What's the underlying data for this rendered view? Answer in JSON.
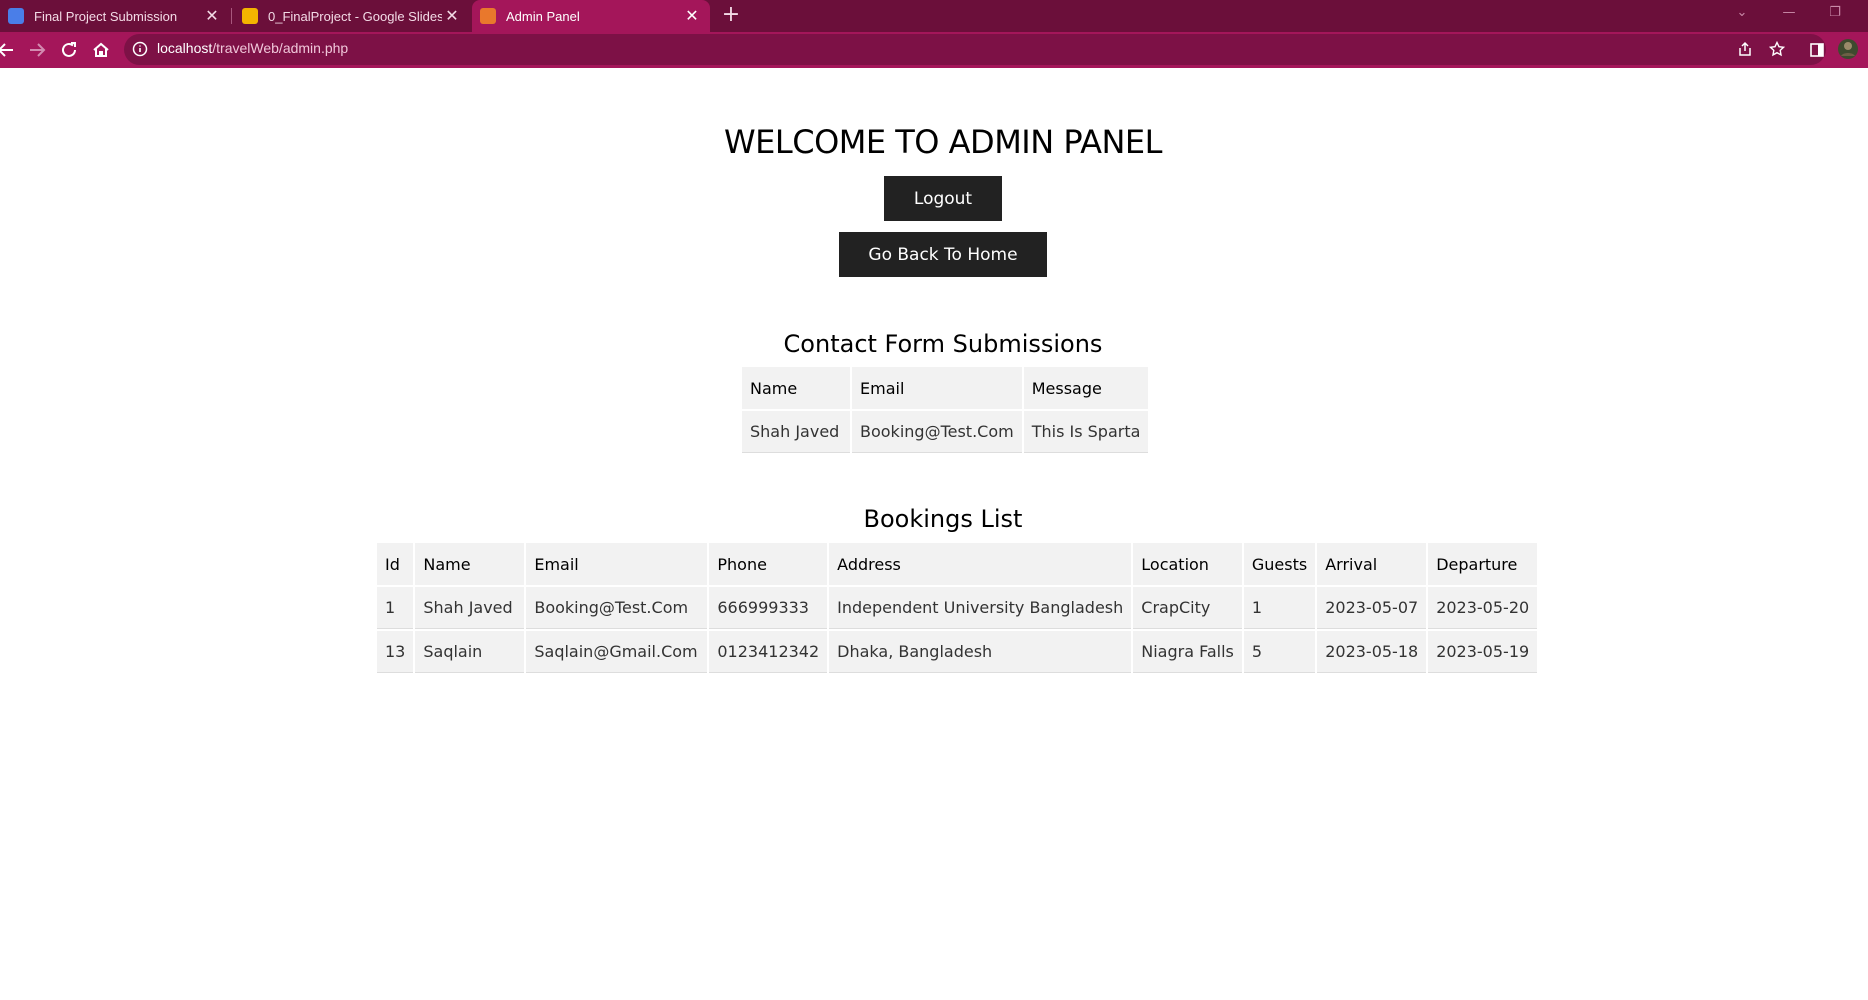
{
  "browser": {
    "tabs": [
      {
        "label": "Final Project Submission",
        "favicon": "#4a7ee8",
        "active": false
      },
      {
        "label": "0_FinalProject - Google Slides",
        "favicon": "#f4b400",
        "active": false
      },
      {
        "label": "Admin Panel",
        "favicon": "#e9782c",
        "active": true
      }
    ],
    "new_tab": "+",
    "url_host": "localhost",
    "url_path": "/travelWeb/admin.php",
    "colors": {
      "tabbar": "#6b0f3a",
      "toolbar": "#a4165a",
      "omnibox": "#7d1146"
    }
  },
  "page": {
    "title": "WELCOME TO ADMIN PANEL",
    "logout_label": "Logout",
    "home_label": "Go Back To Home",
    "contact": {
      "title": "Contact Form Submissions",
      "headers": [
        "Name",
        "Email",
        "Message"
      ],
      "rows": [
        [
          "Shah Javed",
          "Booking@Test.Com",
          "This Is Sparta"
        ]
      ]
    },
    "bookings": {
      "title": "Bookings List",
      "headers": [
        "Id",
        "Name",
        "Email",
        "Phone",
        "Address",
        "Location",
        "Guests",
        "Arrival",
        "Departure"
      ],
      "rows": [
        [
          "1",
          "Shah Javed",
          "Booking@Test.Com",
          "666999333",
          "Independent University Bangladesh",
          "CrapCity",
          "1",
          "2023-05-07",
          "2023-05-20"
        ],
        [
          "13",
          "Saqlain",
          "Saqlain@Gmail.Com",
          "0123412342",
          "Dhaka, Bangladesh",
          "Niagra Falls",
          "5",
          "2023-05-18",
          "2023-05-19"
        ]
      ]
    }
  }
}
